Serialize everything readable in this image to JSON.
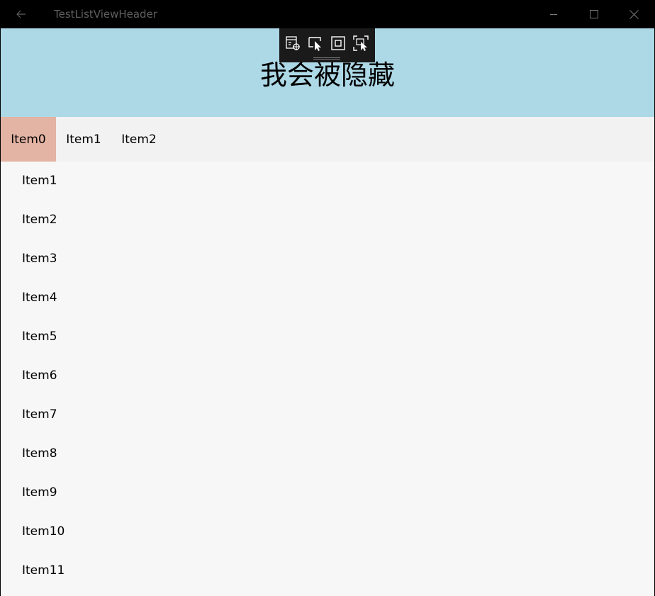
{
  "window": {
    "title": "TestListViewHeader"
  },
  "header": {
    "text": "我会被隐藏"
  },
  "tabs": [
    {
      "label": "Item0",
      "selected": true
    },
    {
      "label": "Item1",
      "selected": false
    },
    {
      "label": "Item2",
      "selected": false
    }
  ],
  "list": {
    "items": [
      "Item1",
      "Item2",
      "Item3",
      "Item4",
      "Item5",
      "Item6",
      "Item7",
      "Item8",
      "Item9",
      "Item10",
      "Item11"
    ]
  },
  "icons": {
    "back": "back-arrow-icon",
    "minimize": "minimize-icon",
    "maximize": "maximize-icon",
    "close": "close-icon",
    "debug": [
      "live-visual-tree-icon",
      "select-element-icon",
      "display-layout-adorners-icon",
      "track-focus-icon"
    ]
  },
  "colors": {
    "titlebar": "#000000",
    "header_banner": "#add8e6",
    "tab_selected": "#e3b3a3",
    "tabs_bar": "#f2f2f2",
    "list_background": "#f7f7f7"
  }
}
